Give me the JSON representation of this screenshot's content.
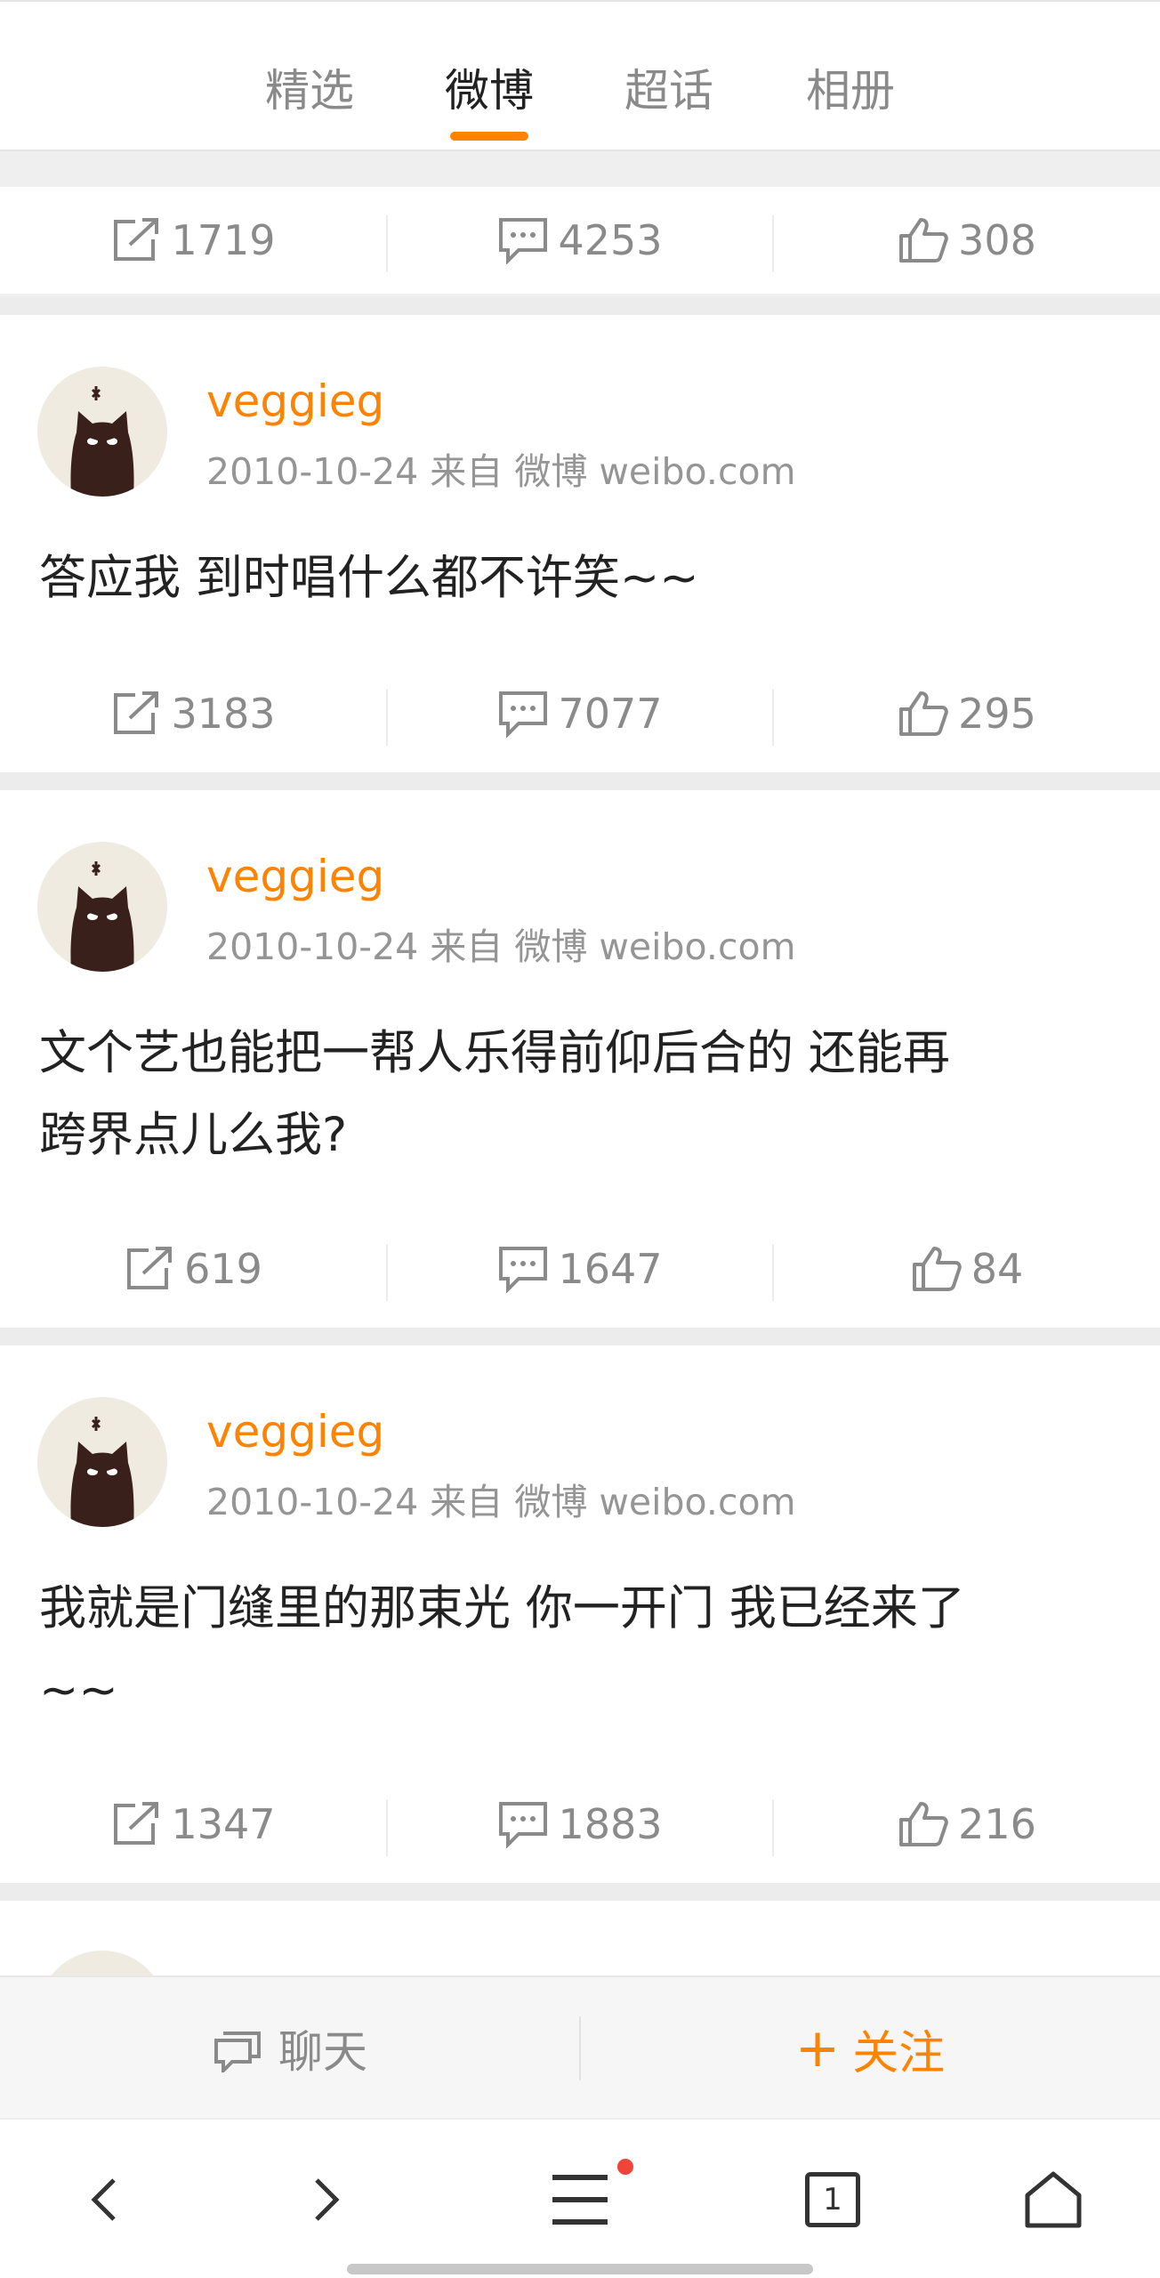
{
  "tabs": [
    {
      "label": "精选"
    },
    {
      "label": "微博"
    },
    {
      "label": "超话"
    },
    {
      "label": "相册"
    }
  ],
  "active_tab": "微博",
  "accent_color": "#ff8200",
  "first_actions": {
    "repost": "1719",
    "comment": "4253",
    "like": "308"
  },
  "posts": [
    {
      "user": "veggieg",
      "meta": "2010-10-24 来自 微博 weibo.com",
      "lines": [
        "答应我 到时唱什么都不许笑~~"
      ],
      "repost": "3183",
      "comment": "7077",
      "like": "295"
    },
    {
      "user": "veggieg",
      "meta": "2010-10-24 来自 微博 weibo.com",
      "lines": [
        "文个艺也能把一帮人乐得前仰后合的 还能再",
        "跨界点儿么我?"
      ],
      "repost": "619",
      "comment": "1647",
      "like": "84"
    },
    {
      "user": "veggieg",
      "meta": "2010-10-24 来自 微博 weibo.com",
      "lines": [
        "我就是门缝里的那束光 你一开门 我已经来了",
        "~~"
      ],
      "repost": "1347",
      "comment": "1883",
      "like": "216"
    }
  ],
  "bottom_bar": {
    "chat_label": "聊天",
    "follow_label": "关注",
    "follow_plus": "+"
  },
  "nav": {
    "tab_count": "1"
  },
  "icons": [
    "repost-icon",
    "comment-icon",
    "like-icon",
    "chat-icon",
    "back-icon",
    "forward-icon",
    "menu-icon",
    "tabs-icon",
    "home-icon"
  ]
}
